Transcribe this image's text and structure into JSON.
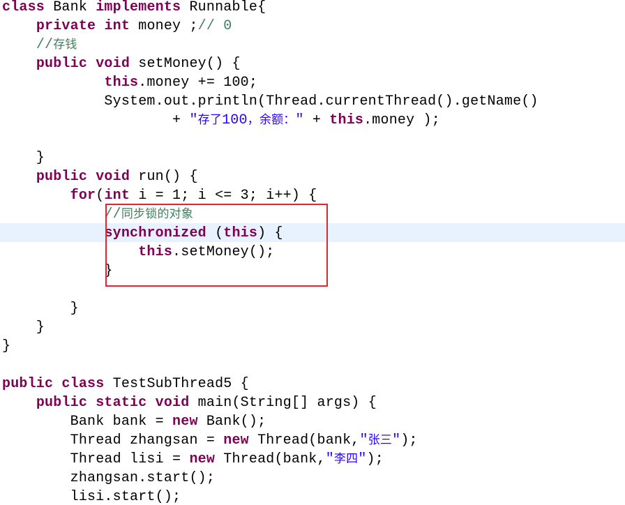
{
  "editor": {
    "colors": {
      "keyword": "#7f0055",
      "comment": "#3f7f5f",
      "string": "#2a00ff",
      "current_line": "#e8f2fe",
      "annotation_box": "#e0262f"
    },
    "lines": [
      [
        {
          "t": "kw",
          "v": "class"
        },
        {
          "t": "pl",
          "v": " Bank "
        },
        {
          "t": "kw",
          "v": "implements"
        },
        {
          "t": "pl",
          "v": " Runnable{"
        }
      ],
      [
        {
          "t": "pl",
          "v": "    "
        },
        {
          "t": "kw",
          "v": "private"
        },
        {
          "t": "pl",
          "v": " "
        },
        {
          "t": "kw",
          "v": "int"
        },
        {
          "t": "pl",
          "v": " money ;"
        },
        {
          "t": "cm",
          "v": "// 0"
        }
      ],
      [
        {
          "t": "pl",
          "v": "    "
        },
        {
          "t": "cm",
          "v": "//存钱"
        }
      ],
      [
        {
          "t": "pl",
          "v": "    "
        },
        {
          "t": "kw",
          "v": "public"
        },
        {
          "t": "pl",
          "v": " "
        },
        {
          "t": "kw",
          "v": "void"
        },
        {
          "t": "pl",
          "v": " setMoney() {"
        }
      ],
      [
        {
          "t": "pl",
          "v": "            "
        },
        {
          "t": "kw",
          "v": "this"
        },
        {
          "t": "pl",
          "v": ".money += 100;"
        }
      ],
      [
        {
          "t": "pl",
          "v": "            System.out.println(Thread.currentThread().getName()"
        }
      ],
      [
        {
          "t": "pl",
          "v": "                    + "
        },
        {
          "t": "st",
          "v": "\"存了100，余额：\""
        },
        {
          "t": "pl",
          "v": " + "
        },
        {
          "t": "kw",
          "v": "this"
        },
        {
          "t": "pl",
          "v": ".money );"
        }
      ],
      [
        {
          "t": "pl",
          "v": ""
        }
      ],
      [
        {
          "t": "pl",
          "v": "    }"
        }
      ],
      [
        {
          "t": "pl",
          "v": "    "
        },
        {
          "t": "kw",
          "v": "public"
        },
        {
          "t": "pl",
          "v": " "
        },
        {
          "t": "kw",
          "v": "void"
        },
        {
          "t": "pl",
          "v": " run() {"
        }
      ],
      [
        {
          "t": "pl",
          "v": "        "
        },
        {
          "t": "kw",
          "v": "for"
        },
        {
          "t": "pl",
          "v": "("
        },
        {
          "t": "kw",
          "v": "int"
        },
        {
          "t": "pl",
          "v": " i = 1; i <= 3; i++) {"
        }
      ],
      [
        {
          "t": "pl",
          "v": "            "
        },
        {
          "t": "cm",
          "v": "//同步锁的对象"
        }
      ],
      [
        {
          "t": "pl",
          "v": "            "
        },
        {
          "t": "kw",
          "v": "synchronized"
        },
        {
          "t": "pl",
          "v": " ("
        },
        {
          "t": "kw",
          "v": "this"
        },
        {
          "t": "pl",
          "v": ") {"
        }
      ],
      [
        {
          "t": "pl",
          "v": "                "
        },
        {
          "t": "kw",
          "v": "this"
        },
        {
          "t": "pl",
          "v": ".setMoney();"
        }
      ],
      [
        {
          "t": "pl",
          "v": "            }"
        }
      ],
      [
        {
          "t": "pl",
          "v": ""
        }
      ],
      [
        {
          "t": "pl",
          "v": "        }"
        }
      ],
      [
        {
          "t": "pl",
          "v": "    }"
        }
      ],
      [
        {
          "t": "pl",
          "v": "}"
        }
      ],
      [
        {
          "t": "pl",
          "v": ""
        }
      ],
      [
        {
          "t": "kw",
          "v": "public"
        },
        {
          "t": "pl",
          "v": " "
        },
        {
          "t": "kw",
          "v": "class"
        },
        {
          "t": "pl",
          "v": " TestSubThread5 {"
        }
      ],
      [
        {
          "t": "pl",
          "v": "    "
        },
        {
          "t": "kw",
          "v": "public"
        },
        {
          "t": "pl",
          "v": " "
        },
        {
          "t": "kw",
          "v": "static"
        },
        {
          "t": "pl",
          "v": " "
        },
        {
          "t": "kw",
          "v": "void"
        },
        {
          "t": "pl",
          "v": " main(String[] args) {"
        }
      ],
      [
        {
          "t": "pl",
          "v": "        Bank bank = "
        },
        {
          "t": "kw",
          "v": "new"
        },
        {
          "t": "pl",
          "v": " Bank();"
        }
      ],
      [
        {
          "t": "pl",
          "v": "        Thread zhangsan = "
        },
        {
          "t": "kw",
          "v": "new"
        },
        {
          "t": "pl",
          "v": " Thread(bank,"
        },
        {
          "t": "st",
          "v": "\"张三\""
        },
        {
          "t": "pl",
          "v": ");"
        }
      ],
      [
        {
          "t": "pl",
          "v": "        Thread lisi = "
        },
        {
          "t": "kw",
          "v": "new"
        },
        {
          "t": "pl",
          "v": " Thread(bank,"
        },
        {
          "t": "st",
          "v": "\"李四\""
        },
        {
          "t": "pl",
          "v": ");"
        }
      ],
      [
        {
          "t": "pl",
          "v": "        zhangsan.start();"
        }
      ],
      [
        {
          "t": "pl",
          "v": "        lisi.start();"
        }
      ]
    ]
  }
}
